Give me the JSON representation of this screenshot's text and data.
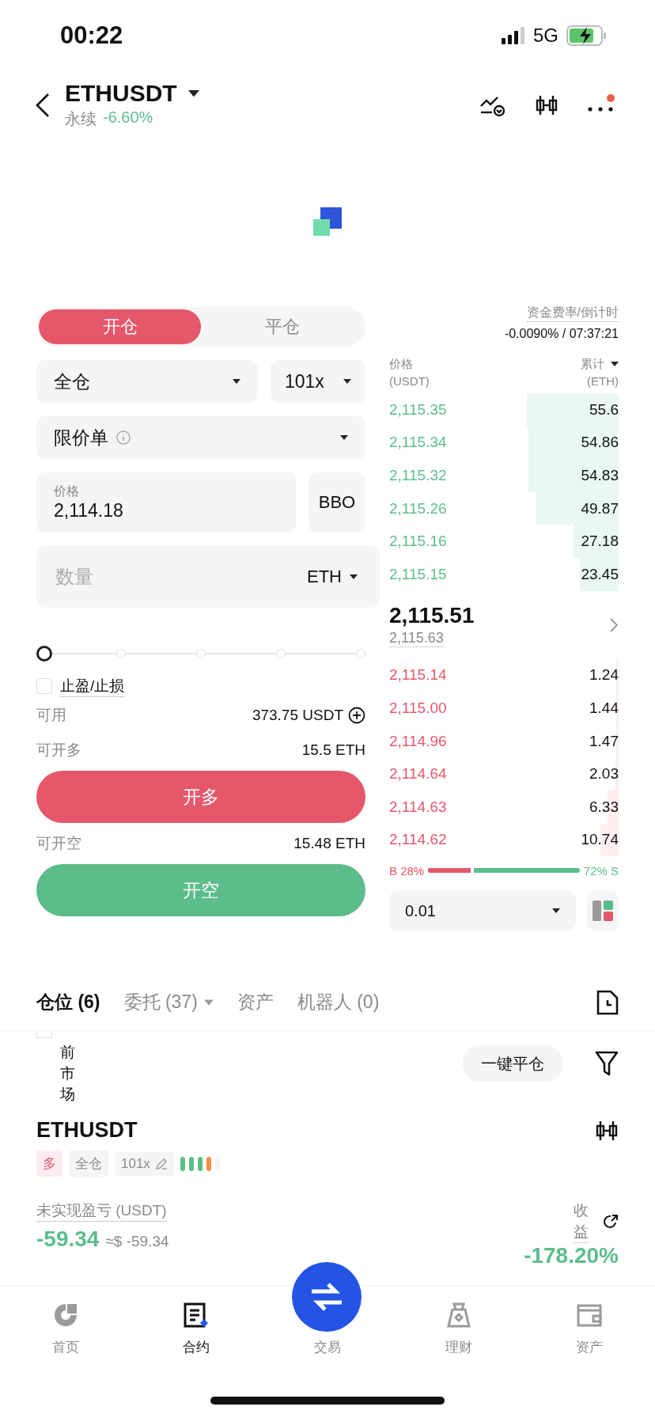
{
  "status_bar": {
    "time": "00:22",
    "network": "5G"
  },
  "header": {
    "symbol": "ETHUSDT",
    "type": "永续",
    "change": "-6.60%"
  },
  "order_form": {
    "tabs": [
      {
        "label": "开仓",
        "selected": true
      },
      {
        "label": "平仓",
        "selected": false
      }
    ],
    "margin_mode": "全仓",
    "leverage": "101x",
    "order_type": "限价单",
    "price": {
      "label": "价格",
      "value": "2,114.18"
    },
    "bbo": "BBO",
    "quantity": {
      "placeholder": "数量",
      "unit": "ETH"
    },
    "slider": {
      "level": 0
    },
    "tp_sl": {
      "label": "止盈/止损",
      "checked": false
    },
    "available": {
      "label": "可用",
      "value": "373.75 USDT"
    },
    "max_long": {
      "label": "可开多",
      "value": "15.5 ETH"
    },
    "long_button": "开多",
    "max_short": {
      "label": "可开空",
      "value": "15.48 ETH"
    },
    "short_button": "开空"
  },
  "order_book": {
    "funding_label": "资金费率/倒计时",
    "funding_value": "-0.0090% / 07:37:21",
    "price_header": "价格",
    "price_unit": "(USDT)",
    "total_header": "累计",
    "total_unit": "(ETH)",
    "asks": [
      {
        "price": "2,115.35",
        "total": "55.6"
      },
      {
        "price": "2,115.34",
        "total": "54.86"
      },
      {
        "price": "2,115.32",
        "total": "54.83"
      },
      {
        "price": "2,115.26",
        "total": "49.87"
      },
      {
        "price": "2,115.16",
        "total": "27.18"
      },
      {
        "price": "2,115.15",
        "total": "23.45"
      }
    ],
    "last_price": "2,115.51",
    "mark_price": "2,115.63",
    "bids": [
      {
        "price": "2,115.14",
        "total": "1.24"
      },
      {
        "price": "2,115.00",
        "total": "1.44"
      },
      {
        "price": "2,114.96",
        "total": "1.47"
      },
      {
        "price": "2,114.64",
        "total": "2.03"
      },
      {
        "price": "2,114.63",
        "total": "6.33"
      },
      {
        "price": "2,114.62",
        "total": "10.74"
      }
    ],
    "buy_ratio": {
      "label": "B 28%",
      "level": 0.28
    },
    "sell_ratio": "72% S",
    "precision": "0.01"
  },
  "positions": {
    "tabs": [
      {
        "label": "仓位 (6)",
        "selected": true,
        "dropdown": false
      },
      {
        "label": "委托 (37)",
        "selected": false,
        "dropdown": true
      },
      {
        "label": "资产",
        "selected": false,
        "dropdown": false
      },
      {
        "label": "机器人 (0)",
        "selected": false,
        "dropdown": false
      }
    ],
    "current_market": {
      "label": "前市场",
      "checked": false
    },
    "close_all": "一键平仓",
    "position": {
      "symbol": "ETHUSDT",
      "tags": [
        {
          "label": "多",
          "kind": "side"
        },
        {
          "label": "全仓",
          "kind": "mode"
        },
        {
          "label": "101x",
          "kind": "leverage"
        }
      ],
      "pnl_label": "未实现盈亏 (USDT)",
      "pnl": "-59.34",
      "pnl_usd": "≈$ -59.34",
      "roe_label": "收益",
      "roe": "-178.20%"
    }
  },
  "nav": [
    {
      "label": "首页",
      "kind": "home",
      "selected": false
    },
    {
      "label": "合约",
      "kind": "contract",
      "selected": true
    },
    {
      "label": "交易",
      "kind": "trade",
      "selected": false
    },
    {
      "label": "理财",
      "kind": "earn",
      "selected": false
    },
    {
      "label": "资产",
      "kind": "assets",
      "selected": false
    }
  ]
}
